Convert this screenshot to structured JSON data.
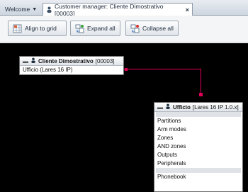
{
  "tabs": [
    {
      "label": "Welcome"
    },
    {
      "label": "Customer manager: Cliente Dimostrativo [00003]"
    }
  ],
  "toolbar": {
    "align_label": "Align to grid",
    "expand_label": "Expand all",
    "collapse_label": "Collapse all"
  },
  "nodes": {
    "customer": {
      "title": "Cliente Dimostrativo",
      "code": "[00003]",
      "rows": [
        "Ufficio (Lares 16 IP)"
      ]
    },
    "office": {
      "title": "Ufficio",
      "model": "[Lares 16 IP 1.0.x]",
      "rows": [
        "Partitions",
        "Arm modes",
        "Zones",
        "AND zones",
        "Outputs",
        "Peripherals"
      ],
      "footer_row": "Phonebook"
    }
  },
  "colors": {
    "connector": "#e10058",
    "canvas": "#000000"
  }
}
